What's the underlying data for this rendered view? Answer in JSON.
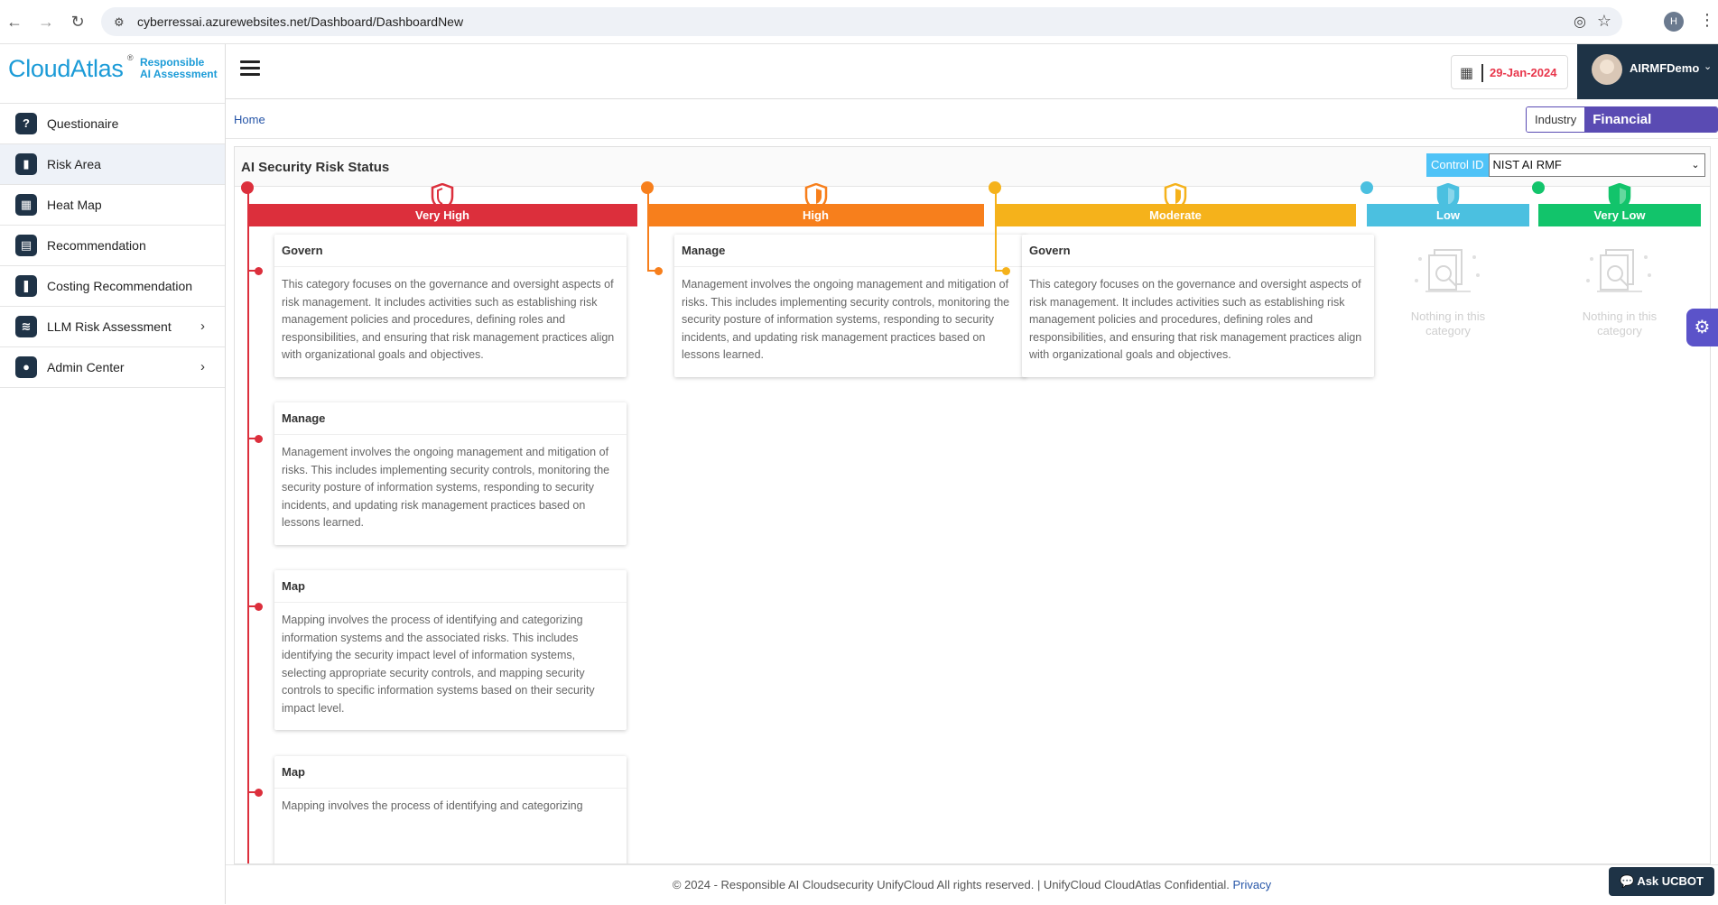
{
  "browser": {
    "url": "cyberressai.azurewebsites.net/Dashboard/DashboardNew",
    "profile_initial": "H"
  },
  "brand": {
    "name_part1": "Cloud",
    "name_part2": "Atlas",
    "registered": "®",
    "tagline_line1": "Responsible",
    "tagline_line2": "AI Assessment"
  },
  "sidebar": {
    "items": [
      {
        "label": "Questionaire",
        "icon": "question-icon",
        "glyph": "?"
      },
      {
        "label": "Risk Area",
        "icon": "clipboard-icon",
        "glyph": "▮"
      },
      {
        "label": "Heat Map",
        "icon": "map-icon",
        "glyph": "▦"
      },
      {
        "label": "Recommendation",
        "icon": "archive-icon",
        "glyph": "▤"
      },
      {
        "label": "Costing Recommendation",
        "icon": "comment-icon",
        "glyph": "❚"
      },
      {
        "label": "LLM Risk Assessment",
        "icon": "layers-icon",
        "glyph": "≋"
      },
      {
        "label": "Admin Center",
        "icon": "user-icon",
        "glyph": "●"
      }
    ]
  },
  "header": {
    "date": "29-Jan-2024",
    "user": "AIRMFDemo"
  },
  "breadcrumb": {
    "home": "Home"
  },
  "industry": {
    "label": "Industry",
    "value": "Financial Services"
  },
  "panel": {
    "title": "AI Security Risk Status",
    "control_label": "Control ID",
    "control_value": "NIST AI RMF"
  },
  "colors": {
    "very_high": "#dc2f3c",
    "high": "#f77f1c",
    "moderate": "#f5b21b",
    "low": "#4bc0e0",
    "very_low": "#12c46b"
  },
  "levels": [
    {
      "label": "Very High"
    },
    {
      "label": "High"
    },
    {
      "label": "Moderate"
    },
    {
      "label": "Low"
    },
    {
      "label": "Very Low"
    }
  ],
  "cards": {
    "very_high": [
      {
        "title": "Govern",
        "body": "This category focuses on the governance and oversight aspects of risk management. It includes activities such as establishing risk management policies and procedures, defining roles and responsibilities, and ensuring that risk management practices align with organizational goals and objectives."
      },
      {
        "title": "Manage",
        "body": "Management involves the ongoing management and mitigation of risks. This includes implementing security controls, monitoring the security posture of information systems, responding to security incidents, and updating risk management practices based on lessons learned."
      },
      {
        "title": "Map",
        "body": "Mapping involves the process of identifying and categorizing information systems and the associated risks. This includes identifying the security impact level of information systems, selecting appropriate security controls, and mapping security controls to specific information systems based on their security impact level."
      },
      {
        "title": "Map",
        "body": "Mapping involves the process of identifying and categorizing"
      }
    ],
    "high": [
      {
        "title": "Manage",
        "body": "Management involves the ongoing management and mitigation of risks. This includes implementing security controls, monitoring the security posture of information systems, responding to security incidents, and updating risk management practices based on lessons learned."
      }
    ],
    "moderate": [
      {
        "title": "Govern",
        "body": "This category focuses on the governance and oversight aspects of risk management. It includes activities such as establishing risk management policies and procedures, defining roles and responsibilities, and ensuring that risk management practices align with organizational goals and objectives."
      }
    ]
  },
  "empty_text_line1": "Nothing in this",
  "empty_text_line2": "category",
  "footer": {
    "text": "© 2024 - Responsible AI Cloudsecurity UnifyCloud All rights reserved. | UnifyCloud CloudAtlas Confidential.",
    "privacy": "Privacy"
  },
  "chatbot": {
    "label": "Ask UCBOT"
  }
}
